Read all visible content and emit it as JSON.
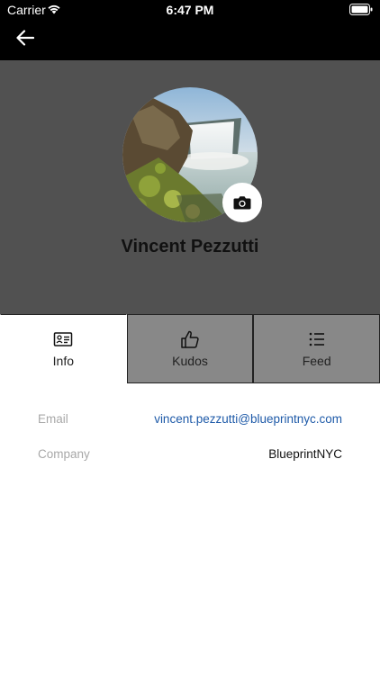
{
  "status_bar": {
    "carrier": "Carrier",
    "time": "6:47 PM"
  },
  "nav": {
    "back_icon": "arrow-left-icon"
  },
  "profile": {
    "name": "Vincent Pezzutti",
    "camera_icon": "camera-icon"
  },
  "tabs": [
    {
      "label": "Info",
      "icon": "id-card-icon",
      "active": true
    },
    {
      "label": "Kudos",
      "icon": "thumbs-up-icon",
      "active": false
    },
    {
      "label": "Feed",
      "icon": "list-icon",
      "active": false
    }
  ],
  "info": {
    "email_label": "Email",
    "email_value": "vincent.pezzutti@blueprintnyc.com",
    "company_label": "Company",
    "company_value": "BlueprintNYC"
  },
  "colors": {
    "header_bg": "#515151",
    "inactive_tab_bg": "#888888",
    "link": "#1e5aa8"
  }
}
